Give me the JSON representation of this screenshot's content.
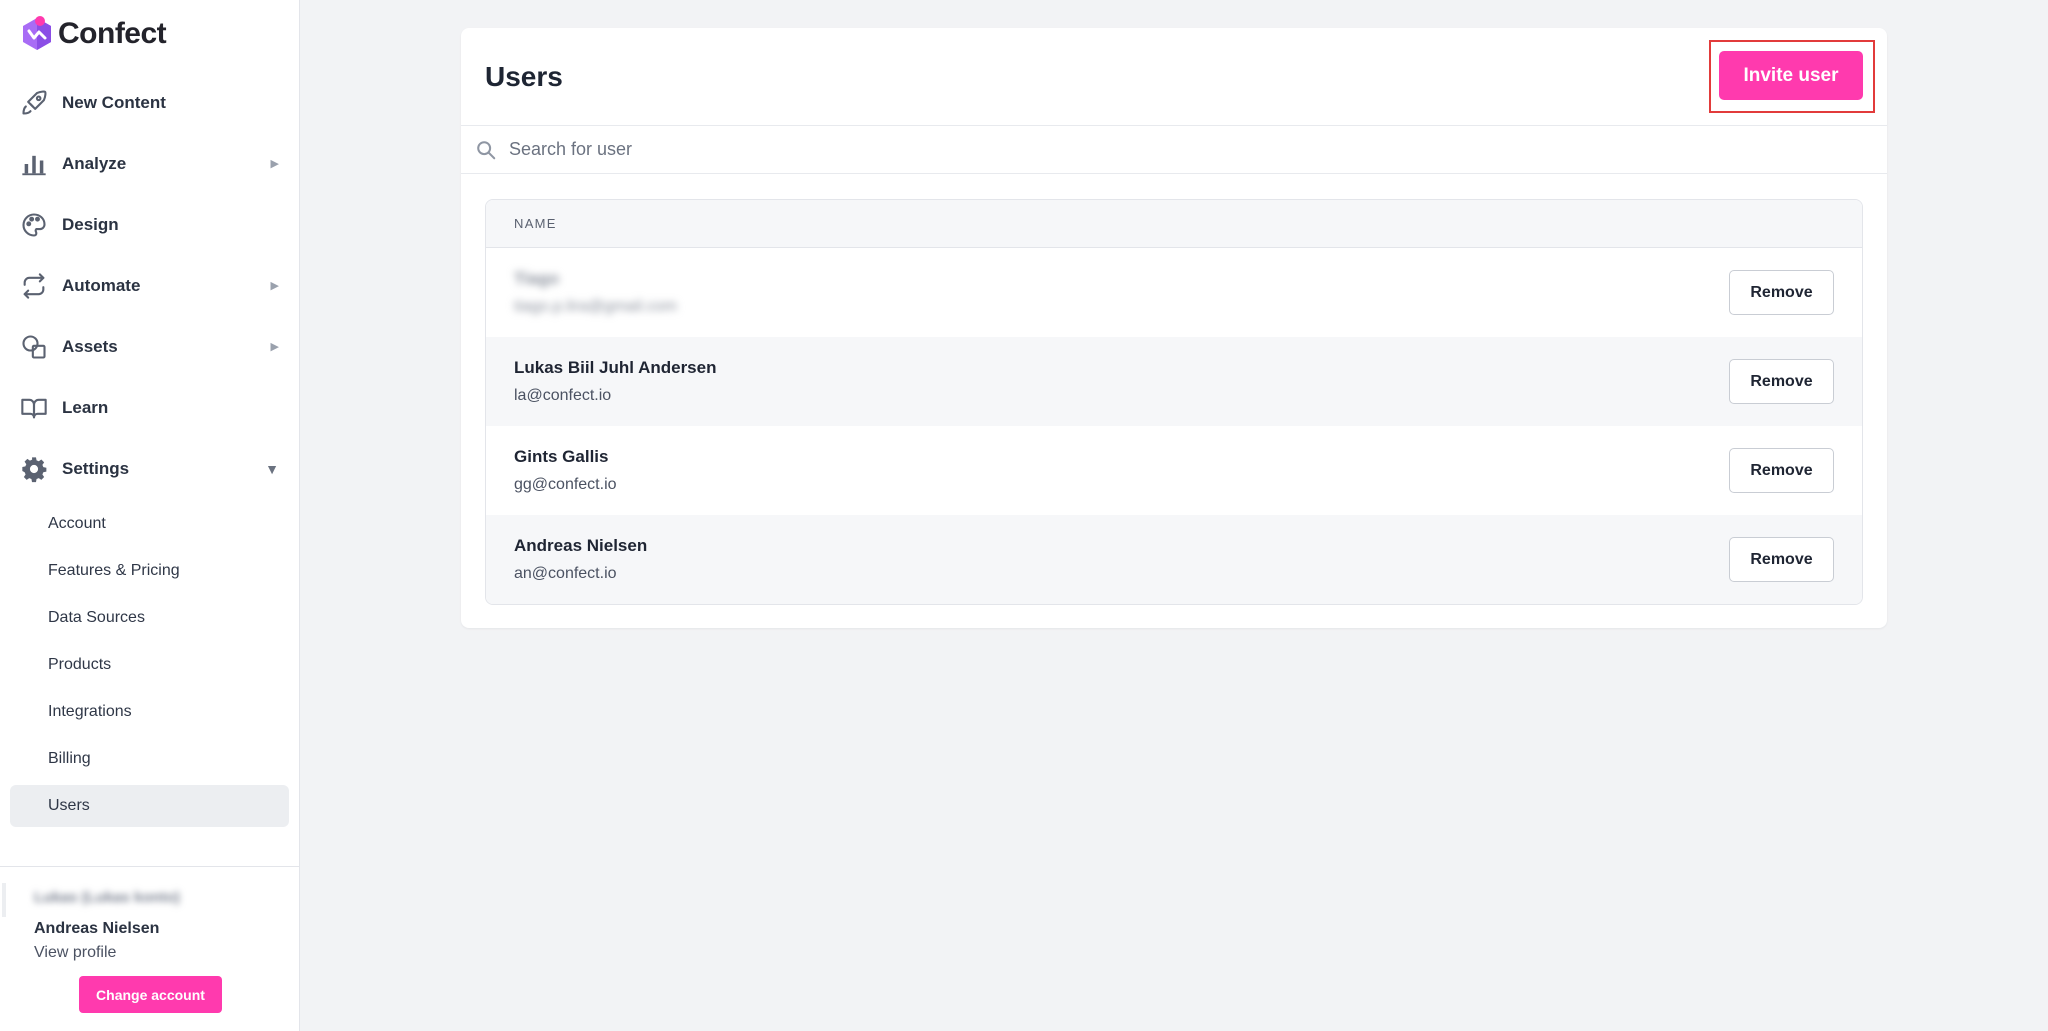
{
  "brand": {
    "name": "Confect",
    "accent": "#ff3aae",
    "logo_purple": "#8b5cf6"
  },
  "sidebar": {
    "nav": [
      {
        "label": "New Content",
        "icon": "rocket-icon"
      },
      {
        "label": "Analyze",
        "icon": "bar-chart-icon",
        "caret": "▶"
      },
      {
        "label": "Design",
        "icon": "palette-icon"
      },
      {
        "label": "Automate",
        "icon": "repeat-icon",
        "caret": "▶"
      },
      {
        "label": "Assets",
        "icon": "shapes-icon",
        "caret": "▶"
      },
      {
        "label": "Learn",
        "icon": "book-icon"
      },
      {
        "label": "Settings",
        "icon": "gear-icon",
        "caret": "▼"
      }
    ],
    "settings_items": [
      {
        "label": "Account"
      },
      {
        "label": "Features & Pricing"
      },
      {
        "label": "Data Sources"
      },
      {
        "label": "Products"
      },
      {
        "label": "Integrations"
      },
      {
        "label": "Billing"
      },
      {
        "label": "Users",
        "active": true
      }
    ],
    "footer": {
      "account_name": "Lukas (Lukas konto)",
      "user_name": "Andreas Nielsen",
      "view_profile": "View profile",
      "change_account": "Change account"
    }
  },
  "main": {
    "title": "Users",
    "invite_button": "Invite user",
    "search": {
      "placeholder": "Search for user",
      "value": ""
    },
    "table": {
      "column": "NAME",
      "remove_label": "Remove",
      "rows": [
        {
          "name": "Tiago",
          "email": "tiago.p.lira@gmail.com",
          "blurred": true
        },
        {
          "name": "Lukas Biil Juhl Andersen",
          "email": "la@confect.io"
        },
        {
          "name": "Gints Gallis",
          "email": "gg@confect.io"
        },
        {
          "name": "Andreas Nielsen",
          "email": "an@confect.io"
        }
      ]
    }
  }
}
